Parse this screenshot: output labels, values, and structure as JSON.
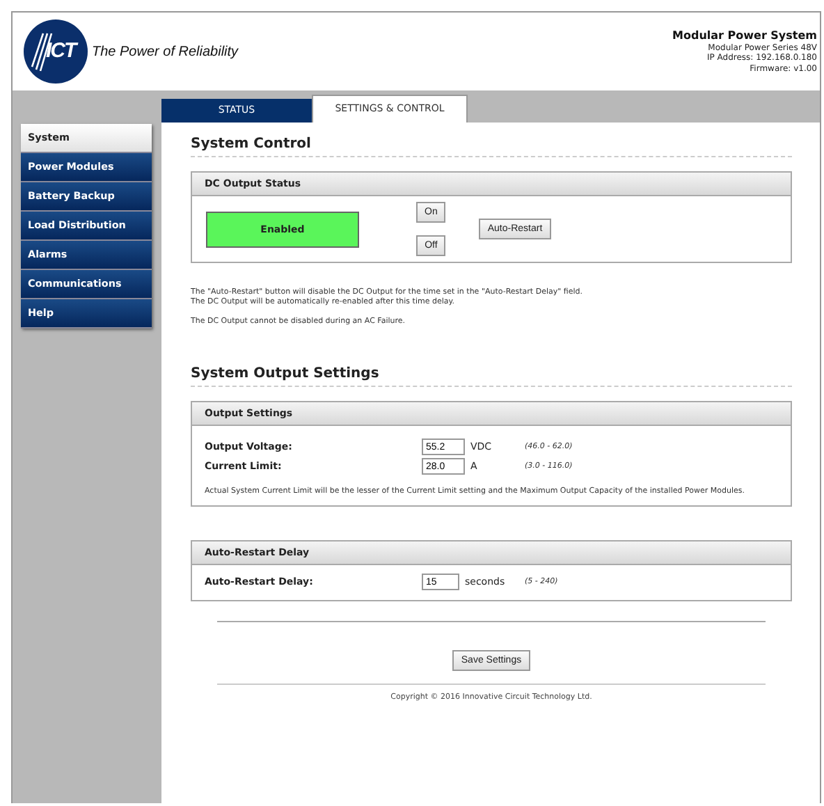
{
  "header": {
    "logo_text": "ICT",
    "tagline": "The Power of Reliability",
    "title": "Modular Power System",
    "model": "Modular Power Series 48V",
    "ip": "IP Address: 192.168.0.180",
    "firmware": "Firmware: v1.00"
  },
  "tabs": [
    {
      "label": "STATUS",
      "selected": false
    },
    {
      "label": "SETTINGS & CONTROL",
      "selected": true
    }
  ],
  "sidebar": {
    "items": [
      {
        "label": "System",
        "selected": true
      },
      {
        "label": "Power Modules",
        "selected": false
      },
      {
        "label": "Battery Backup",
        "selected": false
      },
      {
        "label": "Load Distribution",
        "selected": false
      },
      {
        "label": "Alarms",
        "selected": false
      },
      {
        "label": "Communications",
        "selected": false
      },
      {
        "label": "Help",
        "selected": false
      }
    ]
  },
  "system_control": {
    "heading": "System Control",
    "panel_title": "DC Output Status",
    "status": {
      "label": "Enabled",
      "on": true
    },
    "buttons": [
      "On",
      "Off"
    ],
    "auto_restart_button": "Auto-Restart",
    "notes": [
      "The \"Auto-Restart\" button will disable the DC Output for the time set in the \"Auto-Restart Delay\" field.",
      "The DC Output will be automatically re-enabled after this time delay.",
      "The DC Output cannot be disabled during an AC Failure."
    ]
  },
  "output_settings": {
    "heading": "System Output Settings",
    "panel_title": "Output Settings",
    "fields": [
      {
        "label": "Output Voltage:",
        "value": "55.2",
        "unit": "VDC",
        "range": "(46.0 - 62.0)"
      },
      {
        "label": "Current Limit:",
        "value": "28.0",
        "unit": "A",
        "range": "(3.0 - 116.0)"
      }
    ],
    "note": "Actual System Current Limit will be the lesser of the Current Limit setting and the Maximum Output Capacity of the installed Power Modules."
  },
  "auto_restart": {
    "panel_title": "Auto-Restart Delay",
    "fields": [
      {
        "label": "Auto-Restart Delay:",
        "value": "15",
        "unit": "seconds",
        "range": "(5 - 240)"
      }
    ]
  },
  "save_button": "Save Settings",
  "footer": "Copyright © 2016 Innovative Circuit Technology Ltd."
}
